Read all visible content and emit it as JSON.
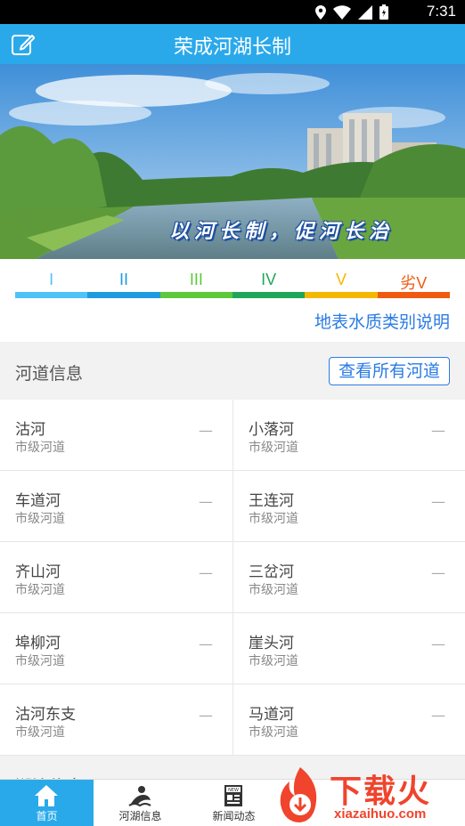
{
  "status_bar": {
    "time": "7:31",
    "icons": [
      "location-icon",
      "wifi-icon",
      "signal-icon",
      "battery-icon"
    ]
  },
  "app_bar": {
    "title": "荣成河湖长制",
    "edit_icon": "edit-icon"
  },
  "banner": {
    "slogan": "以河长制，促河长治"
  },
  "water_quality": {
    "classes": [
      {
        "label": "I",
        "color": "#4fc3f7"
      },
      {
        "label": "II",
        "color": "#1e9be0"
      },
      {
        "label": "III",
        "color": "#5cc93a"
      },
      {
        "label": "IV",
        "color": "#1fa65a"
      },
      {
        "label": "V",
        "color": "#f5b800"
      },
      {
        "label": "劣V",
        "color": "#f05a10"
      }
    ],
    "link": "地表水质类别说明"
  },
  "river_section": {
    "title": "河道信息",
    "view_all": "查看所有河道",
    "rivers": [
      {
        "name": "沽河",
        "type": "市级河道",
        "status": "—"
      },
      {
        "name": "小落河",
        "type": "市级河道",
        "status": "—"
      },
      {
        "name": "车道河",
        "type": "市级河道",
        "status": "—"
      },
      {
        "name": "王连河",
        "type": "市级河道",
        "status": "—"
      },
      {
        "name": "齐山河",
        "type": "市级河道",
        "status": "—"
      },
      {
        "name": "三岔河",
        "type": "市级河道",
        "status": "—"
      },
      {
        "name": "埠柳河",
        "type": "市级河道",
        "status": "—"
      },
      {
        "name": "崖头河",
        "type": "市级河道",
        "status": "—"
      },
      {
        "name": "沽河东支",
        "type": "市级河道",
        "status": "—"
      },
      {
        "name": "马道河",
        "type": "市级河道",
        "status": "—"
      }
    ]
  },
  "next_section": {
    "title": "湖泊信息"
  },
  "tabs": [
    {
      "label": "首页",
      "icon": "home-icon",
      "active": true
    },
    {
      "label": "河湖信息",
      "icon": "river-icon",
      "active": false
    },
    {
      "label": "新闻动态",
      "icon": "news-icon",
      "active": false
    }
  ],
  "watermark": {
    "brand": "下载火",
    "url": "xiazaihuo.com"
  },
  "colors": {
    "primary": "#2aa9ea",
    "link": "#2a7be4"
  }
}
